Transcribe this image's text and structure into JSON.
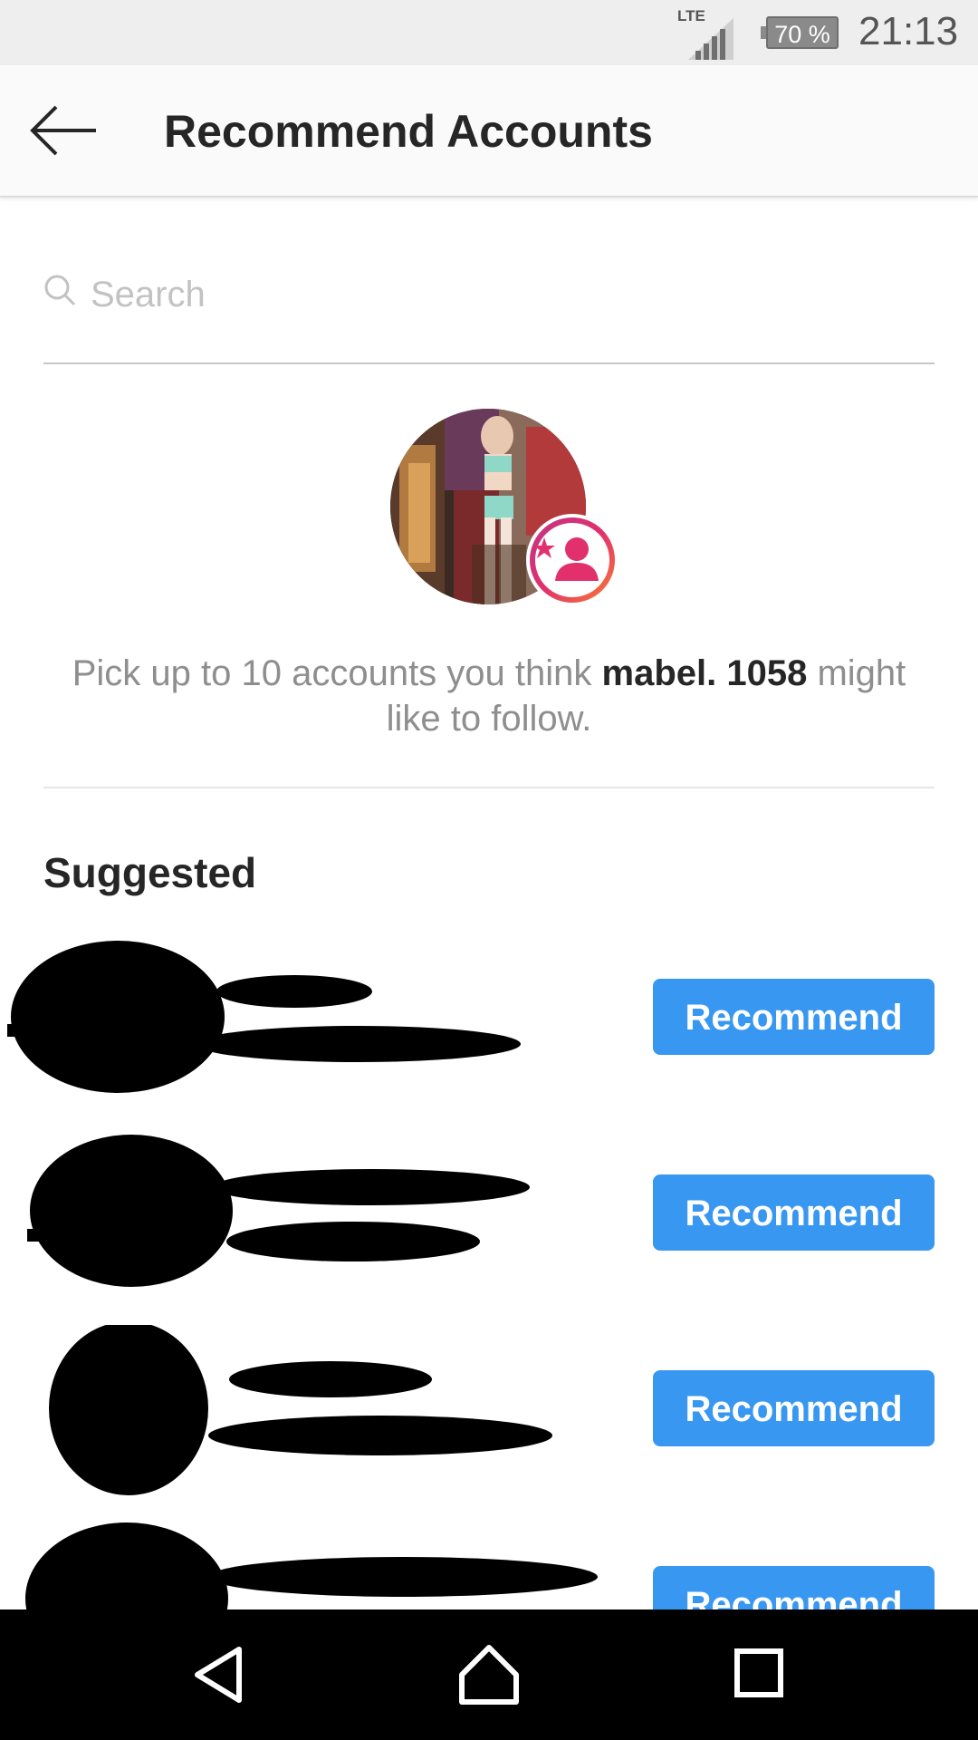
{
  "status_bar": {
    "network": "LTE",
    "battery": "70 %",
    "time": "21:13"
  },
  "action_bar": {
    "title": "Recommend Accounts"
  },
  "search": {
    "placeholder": "Search"
  },
  "prompt": {
    "prefix": "Pick up to 10 accounts you think ",
    "username": "mabel. 1058",
    "suffix": " might like to follow."
  },
  "suggested": {
    "heading": "Suggested",
    "rows": [
      {
        "button_label": "Recommend"
      },
      {
        "button_label": "Recommend"
      },
      {
        "button_label": "Recommend"
      },
      {
        "button_label": "Recommend"
      }
    ]
  },
  "colors": {
    "accent": "#3897f0",
    "badge_gradient": [
      "#dc2743",
      "#f09433"
    ]
  },
  "icons": {
    "back": "arrow-left-icon",
    "search": "search-icon",
    "badge": "recommend-badge-icon",
    "nav_back": "triangle-back-icon",
    "nav_home": "home-icon",
    "nav_recents": "square-recents-icon"
  }
}
